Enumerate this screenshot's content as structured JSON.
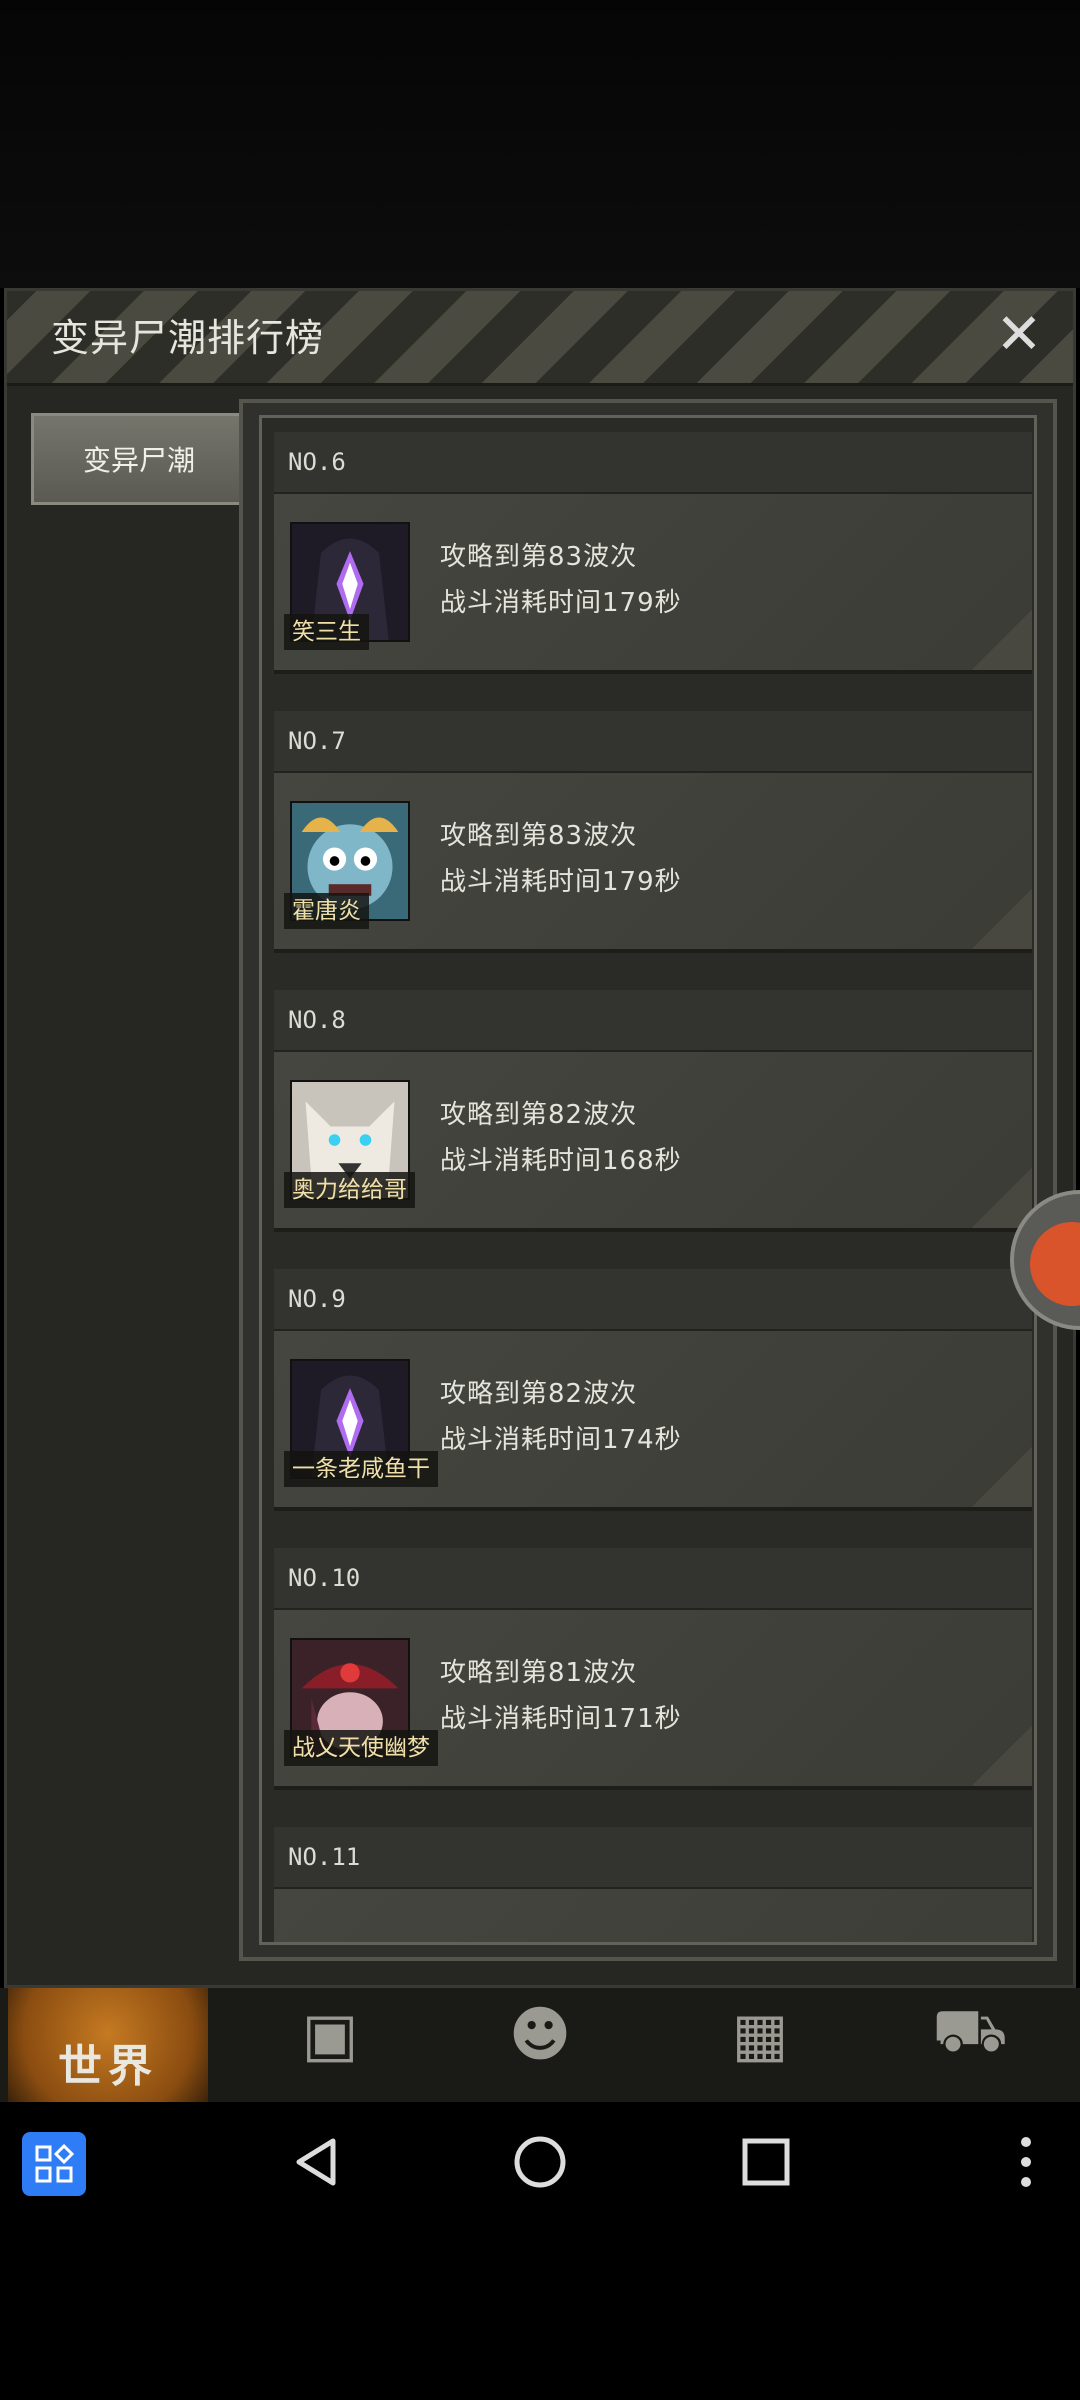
{
  "dialog": {
    "title": "变异尸潮排行榜",
    "close_symbol": "✕",
    "side_tab_label": "变异尸潮"
  },
  "entries": [
    {
      "rank": "NO.6",
      "name": "笑三生",
      "wave_text": "攻略到第83波次",
      "time_text": "战斗消耗时间179秒",
      "avatar": "purple-crystal-hood"
    },
    {
      "rank": "NO.7",
      "name": "霍唐炎",
      "wave_text": "攻略到第83波次",
      "time_text": "战斗消耗时间179秒",
      "avatar": "blue-beast"
    },
    {
      "rank": "NO.8",
      "name": "奥力给给哥",
      "wave_text": "攻略到第82波次",
      "time_text": "战斗消耗时间168秒",
      "avatar": "white-wolf"
    },
    {
      "rank": "NO.9",
      "name": "一条老咸鱼干",
      "wave_text": "攻略到第82波次",
      "time_text": "战斗消耗时间174秒",
      "avatar": "purple-crystal-hood"
    },
    {
      "rank": "NO.10",
      "name": "战乂天使幽梦",
      "wave_text": "攻略到第81波次",
      "time_text": "战斗消耗时间171秒",
      "avatar": "red-hat-girl"
    },
    {
      "rank": "NO.11",
      "name": "",
      "wave_text": "",
      "time_text": "",
      "avatar": ""
    }
  ],
  "game_nav": {
    "world_label": "世界",
    "icons": [
      "backpack-icon",
      "head-profile-icon",
      "building-icon",
      "cart-icon"
    ]
  },
  "colors": {
    "accent": "#c57a22",
    "apps_button": "#2f7df6"
  }
}
